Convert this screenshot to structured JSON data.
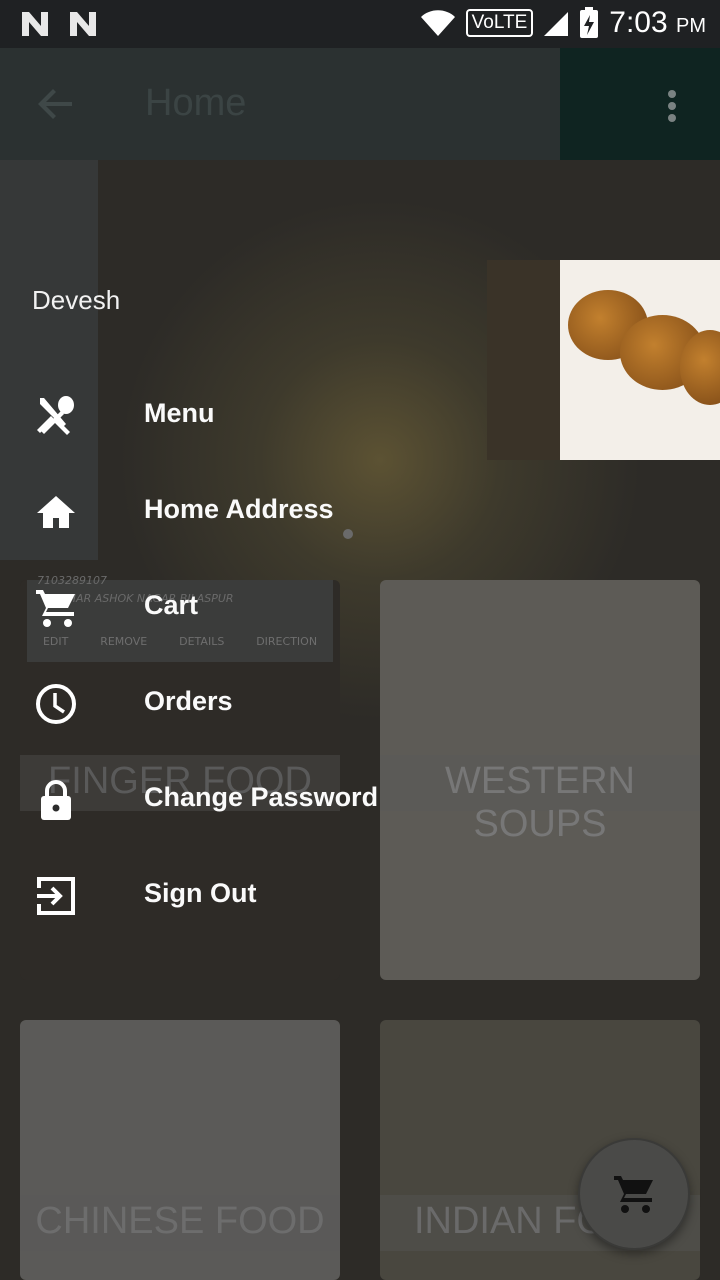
{
  "status_bar": {
    "network": "VoLTE",
    "time": "7:03",
    "ampm": "PM"
  },
  "toolbar": {
    "title": "Home"
  },
  "drawer": {
    "user_name": "Devesh",
    "items": [
      {
        "label": "Menu",
        "icon": "fork-spoon-icon"
      },
      {
        "label": "Home Address",
        "icon": "home-icon"
      },
      {
        "label": "Cart",
        "icon": "cart-icon"
      },
      {
        "label": "Orders",
        "icon": "clock-icon"
      },
      {
        "label": "Change Password",
        "icon": "lock-icon"
      },
      {
        "label": "Sign Out",
        "icon": "sign-out-icon"
      }
    ]
  },
  "address_card": {
    "phone": "7103289107",
    "address": "VIHAR ASHOK NAGAR BILASPUR",
    "actions": [
      "EDIT",
      "REMOVE",
      "DETAILS",
      "DIRECTION"
    ]
  },
  "categories": [
    {
      "label": "FINGER FOOD"
    },
    {
      "label": "WESTERN SOUPS"
    },
    {
      "label": "CHINESE FOOD"
    },
    {
      "label": "INDIAN FO"
    }
  ],
  "fab": {
    "icon": "cart-icon"
  },
  "colors": {
    "toolbar": "#2b3131",
    "accent": "#0f2421"
  }
}
